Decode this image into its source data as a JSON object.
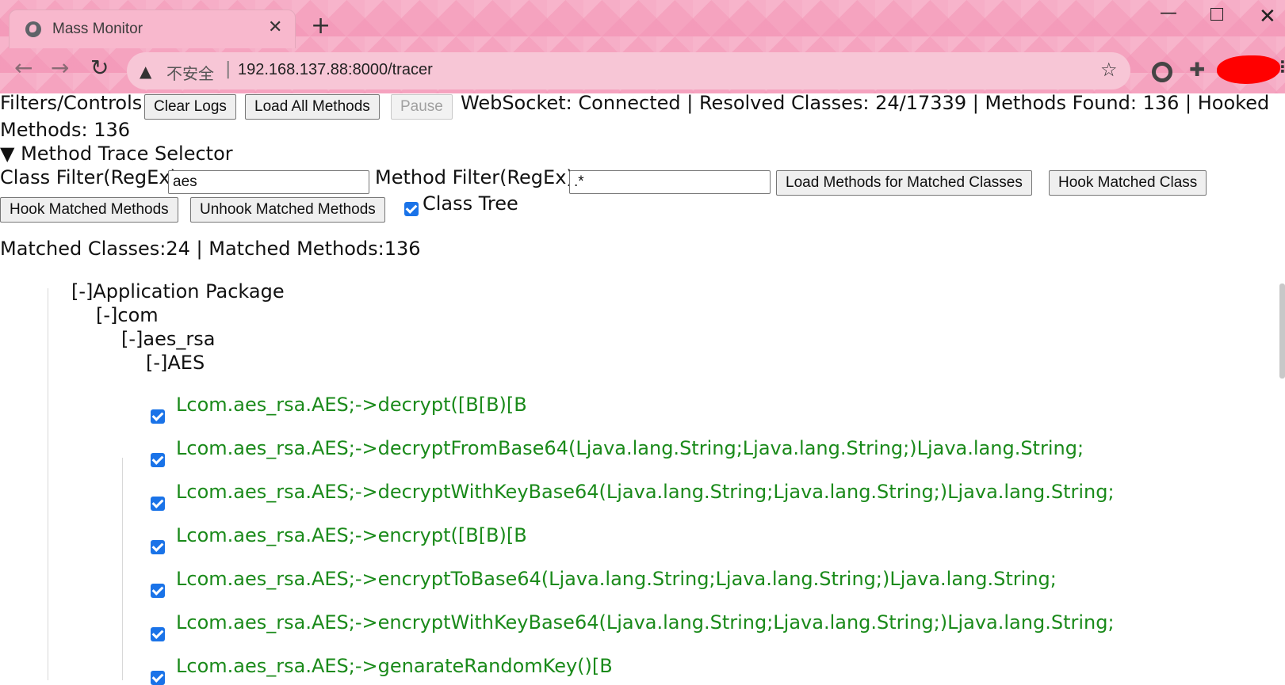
{
  "browser": {
    "tab_title": "Mass Monitor",
    "insecure_label": "不安全",
    "address_separator": "|",
    "url": "192.168.137.88:8000/tracer"
  },
  "controls": {
    "filters_label": "Filters/Controls",
    "clear_logs": "Clear Logs",
    "load_all_methods": "Load All Methods",
    "pause": "Pause",
    "status_line1": "WebSocket: Connected | Resolved Classes: 24/17339 | Methods Found: 136 | Hooked",
    "status_line2": "Methods: 136"
  },
  "selector": {
    "summary": "▼ Method Trace Selector",
    "class_filter_label": "Class Filter(RegEx):",
    "class_filter_value": "aes",
    "method_filter_label": "Method Filter(RegEx):",
    "method_filter_value": ".*",
    "load_methods_button": "Load Methods for Matched Classes",
    "hook_class_button": "Hook Matched Class",
    "hook_methods_button": "Hook Matched Methods",
    "unhook_methods_button": "Unhook Matched Methods",
    "class_tree_label": "Class Tree",
    "class_tree_checked": true
  },
  "summary_line": "Matched Classes:24 | Matched Methods:136",
  "tree": {
    "nodes": [
      "[-]Application Package",
      "[-]com",
      "[-]aes_rsa",
      "[-]AES"
    ],
    "methods": [
      "Lcom.aes_rsa.AES;->decrypt([B[B)[B",
      "Lcom.aes_rsa.AES;->decryptFromBase64(Ljava.lang.String;Ljava.lang.String;)Ljava.lang.String;",
      "Lcom.aes_rsa.AES;->decryptWithKeyBase64(Ljava.lang.String;Ljava.lang.String;)Ljava.lang.String;",
      "Lcom.aes_rsa.AES;->encrypt([B[B)[B",
      "Lcom.aes_rsa.AES;->encryptToBase64(Ljava.lang.String;Ljava.lang.String;)Ljava.lang.String;",
      "Lcom.aes_rsa.AES;->encryptWithKeyBase64(Ljava.lang.String;Ljava.lang.String;)Ljava.lang.String;",
      "Lcom.aes_rsa.AES;->genarateRandomKey()[B"
    ]
  }
}
